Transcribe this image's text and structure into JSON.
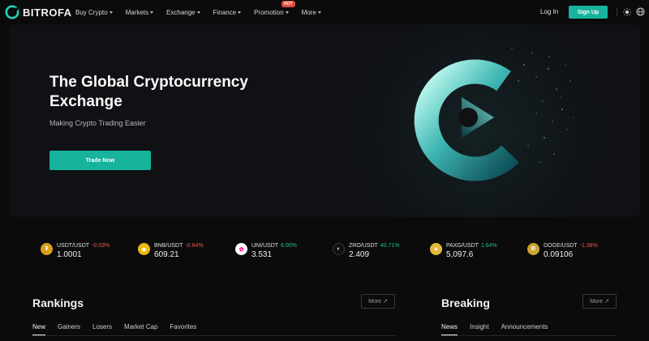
{
  "header": {
    "brand": "BITROFA",
    "menu": [
      {
        "label": "Buy Crypto",
        "hot": false
      },
      {
        "label": "Markets",
        "hot": false
      },
      {
        "label": "Exchange",
        "hot": false
      },
      {
        "label": "Finance",
        "hot": false
      },
      {
        "label": "Promotion",
        "hot": true
      },
      {
        "label": "More",
        "hot": false
      }
    ],
    "hot_badge": "HOT",
    "login": "Log In",
    "signup": "Sign Up",
    "icons": [
      "sun-icon",
      "globe-icon"
    ]
  },
  "hero": {
    "title": "The Global Cryptocurrency Exchange",
    "subtitle": "Making Crypto Trading Easier",
    "cta": "Trade Now"
  },
  "ticker": [
    {
      "pair": "USDT/USDT",
      "change": "-0.03%",
      "dir": "neg",
      "price": "1.0001",
      "color": "#d9a018",
      "glyph": "₮"
    },
    {
      "pair": "BNB/USDT",
      "change": "-0.84%",
      "dir": "neg",
      "price": "609.21",
      "color": "#f0b90b",
      "glyph": "◆"
    },
    {
      "pair": "UNI/USDT",
      "change": "6.00%",
      "dir": "pos",
      "price": "3.531",
      "color": "#ffffff",
      "glyph": "🦄"
    },
    {
      "pair": "ZRO/USDT",
      "change": "40.71%",
      "dir": "pos",
      "price": "2.409",
      "color": "#111111",
      "glyph": "◐"
    },
    {
      "pair": "PAXG/USDT",
      "change": "1.64%",
      "dir": "pos",
      "price": "5,097.6",
      "color": "#e2b93b",
      "glyph": "▲"
    },
    {
      "pair": "DOGE/USDT",
      "change": "-1.38%",
      "dir": "neg",
      "price": "0.09106",
      "color": "#c9a633",
      "glyph": "Ð"
    }
  ],
  "rankings": {
    "title": "Rankings",
    "more": "More ↗",
    "tabs": [
      "New",
      "Gainers",
      "Losers",
      "Market Cap",
      "Favorites"
    ]
  },
  "breaking": {
    "title": "Breaking",
    "more": "More ↗",
    "tabs": [
      "News",
      "Insight",
      "Announcements"
    ]
  },
  "colors": {
    "accent": "#17b39c",
    "negative": "#ea5a4a",
    "positive": "#20c08f",
    "background": "#0b0b0c"
  }
}
